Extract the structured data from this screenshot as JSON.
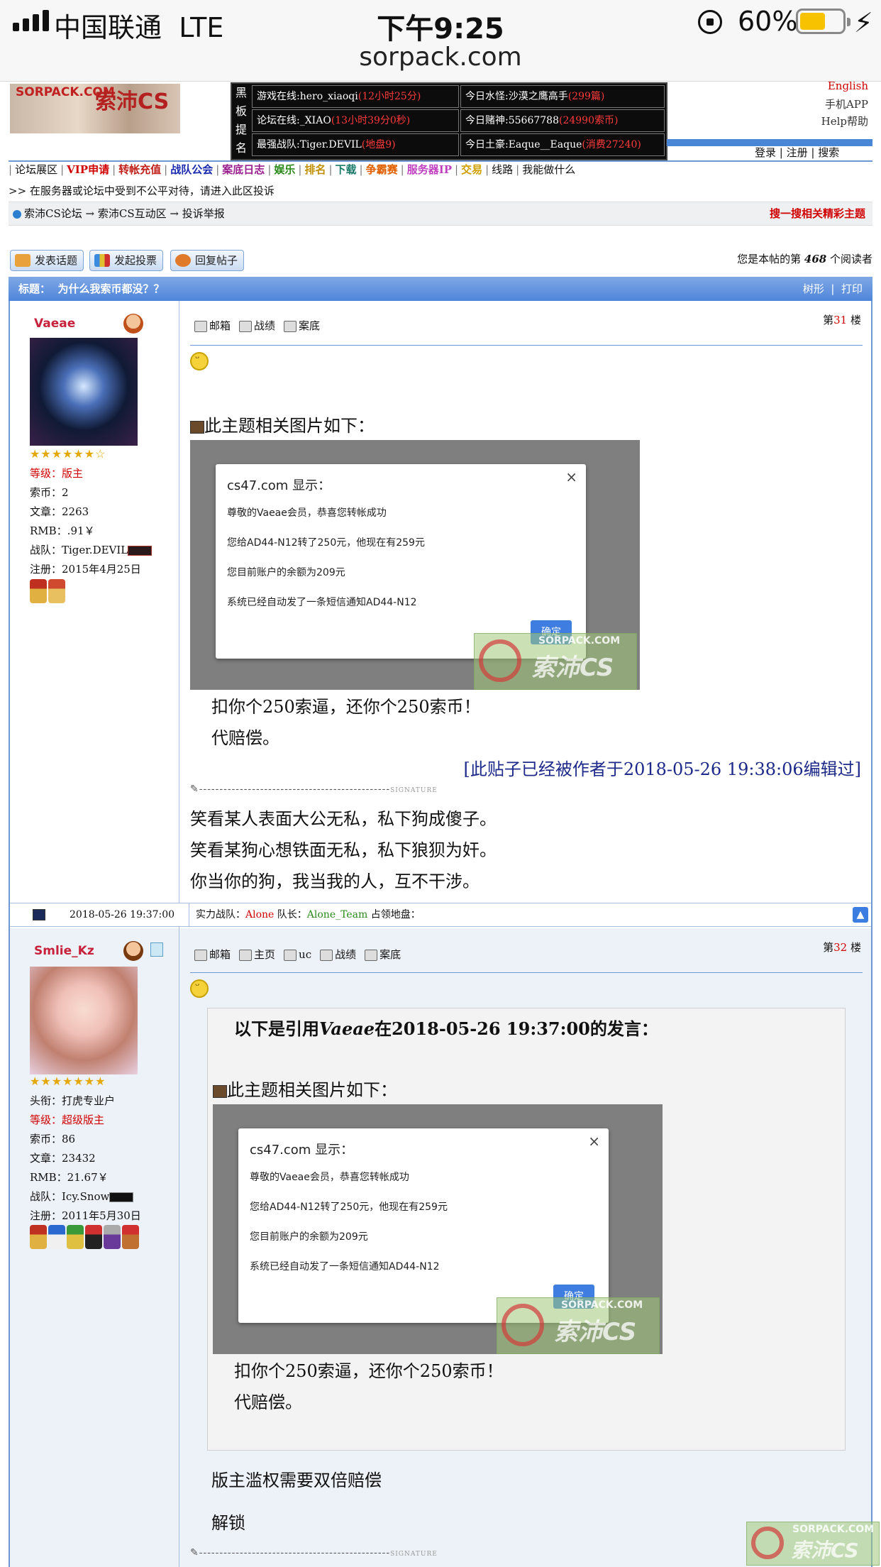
{
  "status_bar": {
    "carrier": "中国联通",
    "network": "LTE",
    "time": "下午9:25",
    "url": "sorpack.com",
    "battery_pct": "60%",
    "battery_level": 0.6,
    "battery_color": "#f7c300"
  },
  "header": {
    "logo_text": "SORPACK.COM",
    "logo_cn": "索沛CS",
    "side_label": [
      "黑",
      "板",
      "提",
      "名"
    ],
    "cells": [
      {
        "label": "游戏在线:hero_xiaoqi",
        "value": "(12小时25分)"
      },
      {
        "label": "今日水怪:沙漠之鹰高手",
        "value": "(299篇)"
      },
      {
        "label": "论坛在线:_XIAO",
        "value": "(13小时39分0秒)"
      },
      {
        "label": "今日赌神:55667788",
        "value": "(24990索币)"
      },
      {
        "label": "最强战队:Tiger.DEVIL",
        "value": "(地盘9)"
      },
      {
        "label": "今日土豪:Eaque__Eaque",
        "value": "(消费27240)"
      }
    ],
    "english": "English",
    "app": "手机APP",
    "help": "Help帮助",
    "login": "登录",
    "register": "注册",
    "search": "搜索"
  },
  "nav": [
    {
      "label": "论坛展区",
      "color": "#111111"
    },
    {
      "label": "VIP申请",
      "color": "#d00000"
    },
    {
      "label": "转帐充值",
      "color": "#c0201a"
    },
    {
      "label": "战队公会",
      "color": "#1a2ab0"
    },
    {
      "label": "案底日志",
      "color": "#9a1f8f"
    },
    {
      "label": "娱乐",
      "color": "#2a8a1a"
    },
    {
      "label": "排名",
      "color": "#c09000"
    },
    {
      "label": "下载",
      "color": "#1a7a6a"
    },
    {
      "label": "争霸赛",
      "color": "#e06000"
    },
    {
      "label": "服务器IP",
      "color": "#c040c0"
    },
    {
      "label": "交易",
      "color": "#d0a000"
    },
    {
      "label": "线路",
      "color": "#111111"
    },
    {
      "label": "我能做什么",
      "color": "#111111"
    }
  ],
  "notice": ">> 在服务器或论坛中受到不公平对待，请进入此区投诉",
  "breadcrumb": "索沛CS论坛 → 索沛CS互动区 → 投诉举报",
  "breadcrumb_search": "搜一搜相关精彩主题",
  "buttons": {
    "new_topic": "发表话题",
    "new_poll": "发起投票",
    "reply": "回复帖子"
  },
  "readers": {
    "prefix": "您是本帖的第",
    "count": "468",
    "suffix": "个阅读者"
  },
  "title_bar": {
    "label": "标题：",
    "title": "为什么我索币都没？？",
    "tree": "树形",
    "print": "打印"
  },
  "post1": {
    "username": "Vaeae",
    "stars": "★★★★★★☆",
    "level_label": "等级：",
    "level": "版主",
    "coins": "索币：2",
    "articles": "文章：2263",
    "rmb": "RMB：.91￥",
    "team": "战队：Tiger.DEVIL",
    "registered": "注册：2015年4月25日",
    "tools": [
      "邮箱",
      "战绩",
      "案底"
    ],
    "floor_prefix": "第",
    "floor": "31",
    "floor_suffix": "楼",
    "image_caption": "此主题相关图片如下：",
    "dialog": {
      "title": "cs47.com 显示：",
      "line1": "尊敬的Vaeae会员，恭喜您转帐成功",
      "line2": "您给AD44-N12转了250元，他现在有259元",
      "line3": "您目前账户的余额为209元",
      "line4": "系统已经自动发了一条短信通知AD44-N12",
      "ok": "确定"
    },
    "text1": "扣你个250索逼，还你个250索币！",
    "text2": "代赔偿。",
    "edited": "[此贴子已经被作者于2018-05-26 19:38:06编辑过]",
    "sig_label": "SIGNATURE",
    "signature": [
      "笑看某人表面大公无私，私下狗成傻子。",
      "笑看某狗心想铁面无私，私下狼狈为奸。",
      "你当你的狗，我当我的人，互不干涉。"
    ]
  },
  "meta": {
    "datetime": "2018-05-26 19:37:00",
    "team_label": "实力战队：",
    "team": "Alone",
    "captain_label": "队长：",
    "captain": "Alone_Team",
    "territory": "占领地盘："
  },
  "post2": {
    "username": "Smlie_Kz",
    "stars": "★★★★★★★",
    "title": "头衔：打虎专业户",
    "level_label": "等级：",
    "level": "超级版主",
    "coins": "索币：86",
    "articles": "文章：23432",
    "rmb": "RMB：21.67￥",
    "team": "战队：Icy.Snow",
    "registered": "注册：2011年5月30日",
    "tools": [
      "邮箱",
      "主页",
      "uc",
      "战绩",
      "案底"
    ],
    "floor_prefix": "第",
    "floor": "32",
    "floor_suffix": "楼",
    "quote_head_pre": "以下是引用",
    "quote_author": "Vaeae",
    "quote_head_post": "在2018-05-26 19:37:00的发言：",
    "reply1": "版主滥权需要双倍赔偿",
    "reply2": "解锁"
  },
  "watermark": {
    "url": "SORPACK.COM",
    "text": "索沛CS"
  }
}
